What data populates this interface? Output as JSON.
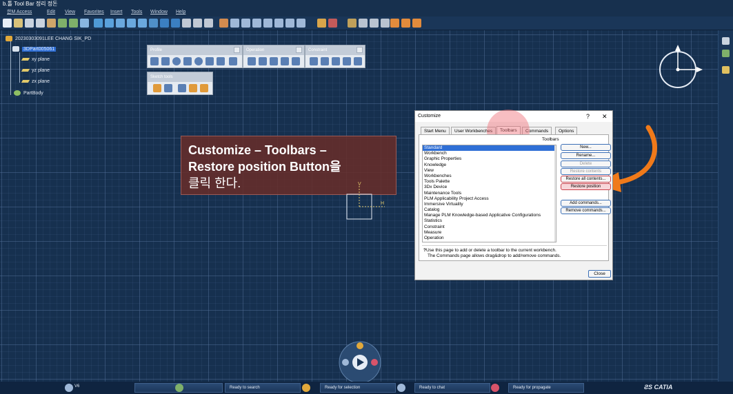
{
  "window": {
    "title": "b.톨 Tool Bar 정리 정돈"
  },
  "menu": [
    "한M Access",
    "Edit",
    "View",
    "Favorites",
    "Insert",
    "Tools",
    "Window",
    "Help"
  ],
  "tree": {
    "root": "20230303091LEE CHANG SIK_PD",
    "part": "3DPart005061",
    "children": [
      "xy plane",
      "yz plane",
      "zx plane",
      "PartBody"
    ]
  },
  "floating_toolbars": {
    "profile": "Profile",
    "operation": "Operation",
    "constraint": "Constraint",
    "sketch_tools": "Sketch tools"
  },
  "annotation": {
    "line1": "Customize – Toolbars –",
    "line2": "Restore position Button을",
    "line3": "클릭 한다."
  },
  "axis": {
    "v": "V",
    "h": "H"
  },
  "dialog": {
    "title": "Customize",
    "help": "?",
    "close_x": "✕",
    "tabs": [
      "Start Menu",
      "User Workbenches",
      "Toolbars",
      "Commands",
      "Options"
    ],
    "list_header": "Toolbars",
    "items": [
      "Standard",
      "Workbench",
      "Graphic Properties",
      "Knowledge",
      "View",
      "Workbenches",
      "Tools Palette",
      "3Dx Device",
      "Maintenance Tools",
      "PLM Applicability Project Access",
      "Immersive Virtuality",
      "Catalog",
      "Manage PLM Knowledge-based Applicative Configurations",
      "Statistics",
      "Constraint",
      "Measure",
      "Operation"
    ],
    "buttons": {
      "new": "New...",
      "rename": "Rename...",
      "delete": "Delete",
      "restore_contents": "Restore contents",
      "restore_all": "Restore all contents...",
      "restore_position": "Restore position",
      "add_commands": "Add commands...",
      "remove_commands": "Remove commands..."
    },
    "help_line1": "Use this page to add or delete a toolbar to the current workbench.",
    "help_line2": "The Commands page allows drag&drop to add/remove commands.",
    "close_button": "Close"
  },
  "status": {
    "v6": "V6",
    "search": "Ready to search",
    "selection": "Ready for selection",
    "chat": "Ready to chat",
    "propagate": "Ready for propagate",
    "brand": "CATIA"
  },
  "colors": {
    "accent_orange": "#f07a1a",
    "highlight_red": "#e0707a",
    "selection_blue": "#2f6fd6"
  }
}
